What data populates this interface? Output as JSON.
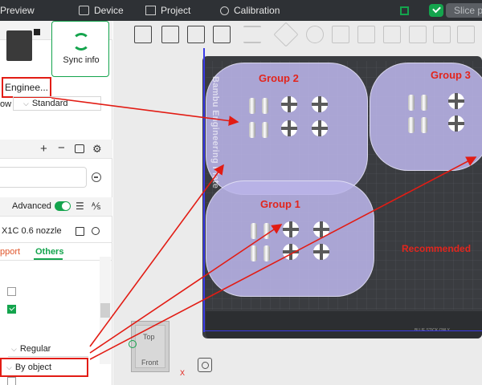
{
  "topbar": {
    "preview": "Preview",
    "device": "Device",
    "project": "Project",
    "calibration": "Calibration",
    "slice_label": "Slice pl"
  },
  "printer": {
    "preset_label": "Enginee...",
    "sync_label": "Sync info"
  },
  "flow": {
    "label": "ow",
    "value": "Standard"
  },
  "process": {
    "advanced_label": "Advanced",
    "advanced_on": true,
    "preset_name": "X1C 0.6 nozzle",
    "tabs": [
      "pport",
      "Others"
    ],
    "active_tab": "Others",
    "options": {
      "checkbox_1": false,
      "checkbox_2": true
    },
    "select_regular": "Regular",
    "select_by_object": "By object"
  },
  "viewport": {
    "plate_name": "Bambu Engineering Plate",
    "groups": [
      "Group 2",
      "Group 3",
      "Group 1"
    ],
    "recommended_label": "Recommended",
    "view_cube": {
      "top": "Top",
      "front": "Front"
    },
    "axis_x": "X",
    "strip_text": "BLUE STICK ONLY"
  },
  "colors": {
    "accent": "#14a44d",
    "highlight": "#e21c14",
    "group_fill": "#bab4e8",
    "plate": "#3a3c40",
    "topbar": "#2e3135"
  },
  "icons": [
    "preview-icon",
    "device-icon",
    "project-icon",
    "calibration-icon",
    "gear-icon",
    "sync-icon",
    "plus-icon",
    "minus-icon",
    "list-icon",
    "eraser-icon",
    "save-icon",
    "search-icon",
    "fit-view-icon"
  ]
}
